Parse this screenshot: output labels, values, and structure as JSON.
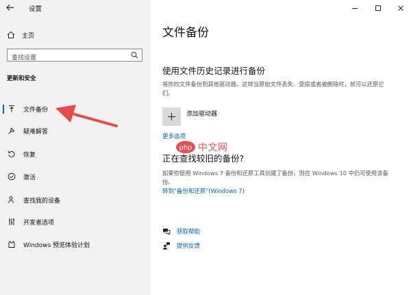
{
  "window": {
    "title": "设置"
  },
  "sidebar": {
    "home_label": "主页",
    "search_placeholder": "查找设置",
    "section_title": "更新和安全",
    "items": [
      {
        "label": "文件备份",
        "icon": "upload-arrow-icon",
        "selected": true
      },
      {
        "label": "疑难解答",
        "icon": "wrench-icon"
      },
      {
        "label": "恢复",
        "icon": "recovery-icon"
      },
      {
        "label": "激活",
        "icon": "check-circle-icon"
      },
      {
        "label": "查找我的设备",
        "icon": "person-location-icon"
      },
      {
        "label": "开发者选项",
        "icon": "developer-sliders-icon"
      },
      {
        "label": "Windows 预览体验计划",
        "icon": "insider-cat-icon"
      }
    ]
  },
  "main": {
    "title": "文件备份",
    "file_history": {
      "heading": "使用文件历史记录进行备份",
      "description": "将你的文件备份到其他驱动器，这样当原始文件丢失、受损或者被删除时，就可以还原它们。",
      "add_drive_label": "添加驱动器",
      "more_options": "更多选项"
    },
    "older_backup": {
      "heading": "正在查找较旧的备份?",
      "description": "如果你使用 Windows 7 备份和还原工具创建了备份，则在 Windows 10 中仍可使用该备份。",
      "link": "转到\"备份和还原\"(Windows 7)"
    },
    "help": {
      "get_help": "获取帮助",
      "feedback": "提供反馈"
    }
  },
  "watermark": {
    "text": "中文网",
    "logo_text": "php"
  },
  "colors": {
    "accent": "#0063b1",
    "sidebar_bg": "#f2f2f2",
    "annotation_arrow": "#e84a4a"
  }
}
